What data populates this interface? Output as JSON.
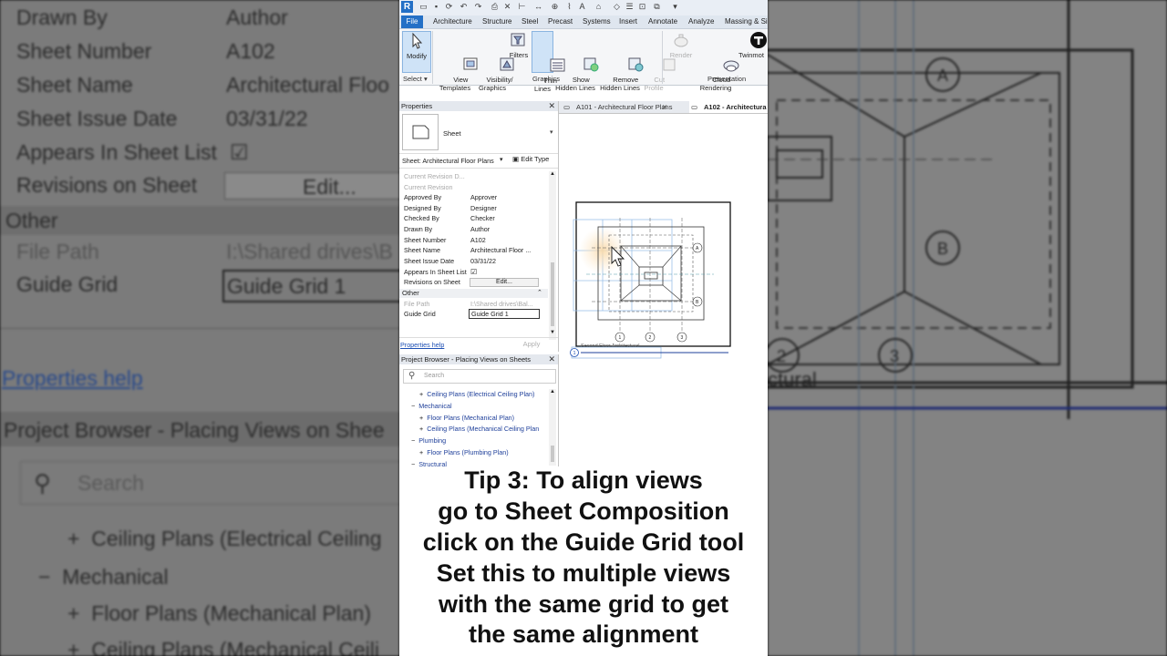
{
  "background_left": {
    "rows": [
      {
        "label": "Drawn By",
        "value": "Author"
      },
      {
        "label": "Sheet Number",
        "value": "A102"
      },
      {
        "label": "Sheet Name",
        "value": "Architectural Floo"
      },
      {
        "label": "Sheet Issue Date",
        "value": "03/31/22"
      },
      {
        "label": "Appears In Sheet List",
        "value": "☑"
      },
      {
        "label": "Revisions on Sheet",
        "value": "Edit..."
      }
    ],
    "other_label": "Other",
    "file_path_label": "File Path",
    "file_path_value": "I:\\Shared drives\\B",
    "guide_grid_label": "Guide Grid",
    "guide_grid_value": "Guide Grid 1",
    "properties_help": "Properties help",
    "browser_title": "Project Browser - Placing Views on Shee",
    "search": "Search",
    "tree": [
      "Ceiling Plans (Electrical Ceiling",
      "Mechanical",
      "Floor Plans (Mechanical Plan)",
      "Ceiling Plans (Mechanical Ceili"
    ]
  },
  "background_right": {
    "grid_labels": [
      "A",
      "B",
      "2",
      "3"
    ],
    "text": "ctural"
  },
  "app": {
    "logo": "R",
    "ribbon_tabs": [
      "File",
      "Architecture",
      "Structure",
      "Steel",
      "Precast",
      "Systems",
      "Insert",
      "Annotate",
      "Analyze",
      "Massing & Si"
    ],
    "tools": [
      {
        "label": "Modify"
      },
      {
        "label": "View\nTemplates"
      },
      {
        "label": "Visibility/\nGraphics"
      },
      {
        "label": "Filters"
      },
      {
        "label": "Thin\nLines"
      },
      {
        "label": "Show\nHidden Lines"
      },
      {
        "label": "Remove\nHidden Lines"
      },
      {
        "label": "Cut\nProfile"
      },
      {
        "label": "Render"
      },
      {
        "label": "Cloud\nRendering"
      },
      {
        "label": "Twinmot"
      }
    ],
    "panels": {
      "select": "Select",
      "graphics": "Graphics",
      "presentation": "Presentation"
    },
    "properties": {
      "title": "Properties",
      "type_name": "Sheet",
      "instance": "Sheet: Architectural Floor Plans",
      "edit_type": "Edit Type",
      "rows": [
        {
          "label": "Current Revision D...",
          "value": "",
          "dim": true
        },
        {
          "label": "Current Revision",
          "value": "",
          "dim": true
        },
        {
          "label": "Approved By",
          "value": "Approver"
        },
        {
          "label": "Designed By",
          "value": "Designer"
        },
        {
          "label": "Checked By",
          "value": "Checker"
        },
        {
          "label": "Drawn By",
          "value": "Author"
        },
        {
          "label": "Sheet Number",
          "value": "A102"
        },
        {
          "label": "Sheet Name",
          "value": "Architectural Floor ..."
        },
        {
          "label": "Sheet Issue Date",
          "value": "03/31/22"
        },
        {
          "label": "Appears In Sheet List",
          "value": "☑"
        },
        {
          "label": "Revisions on Sheet",
          "value": "Edit..."
        }
      ],
      "other": "Other",
      "file_path_label": "File Path",
      "file_path_value": "I:\\Shared drives\\Bal...",
      "guide_grid_label": "Guide Grid",
      "guide_grid_value": "Guide Grid 1",
      "help": "Properties help",
      "apply": "Apply"
    },
    "browser": {
      "title": "Project Browser - Placing Views on Sheets",
      "search": "Search",
      "items": [
        {
          "text": "Ceiling Plans (Electrical Ceiling Plan)",
          "indent": 2,
          "sign": "+"
        },
        {
          "text": "Mechanical",
          "indent": 1,
          "sign": "−"
        },
        {
          "text": "Floor Plans (Mechanical Plan)",
          "indent": 2,
          "sign": "+"
        },
        {
          "text": "Ceiling Plans (Mechanical Ceiling Plan",
          "indent": 2,
          "sign": "+"
        },
        {
          "text": "Plumbing",
          "indent": 1,
          "sign": "−"
        },
        {
          "text": "Floor Plans (Plumbing Plan)",
          "indent": 2,
          "sign": "+"
        },
        {
          "text": "Structural",
          "indent": 1,
          "sign": "−"
        }
      ]
    },
    "view_tabs": [
      {
        "label": "A101 - Architectural Floor Plans",
        "active": false
      },
      {
        "label": "A102 - Architectura",
        "active": true
      }
    ],
    "canvas": {
      "view_title": "Second Floor Architectural",
      "view_number": "1",
      "grid_bubbles": [
        "A",
        "B",
        "1",
        "2",
        "3"
      ]
    }
  },
  "caption": {
    "lines": [
      "Tip 3: To align views",
      "go to Sheet Composition",
      "click on the Guide Grid tool",
      "Set this to multiple views",
      "with the same grid to get",
      "the same alignment"
    ]
  }
}
